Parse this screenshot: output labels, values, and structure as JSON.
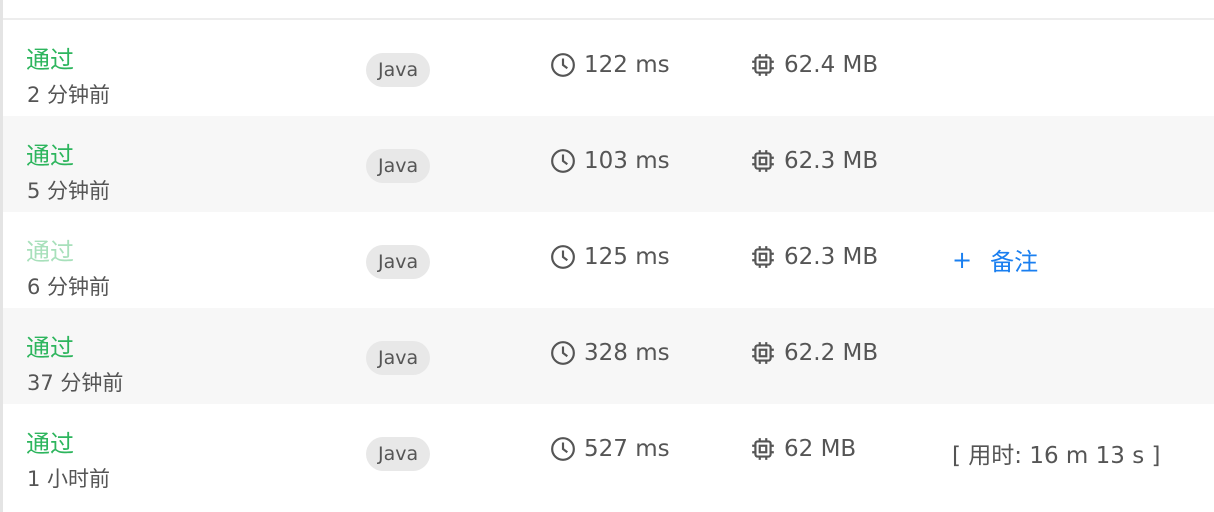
{
  "rows": [
    {
      "status": "通过",
      "time": "2 分钟前",
      "language": "Java",
      "runtime": "122 ms",
      "memory": "62.4 MB",
      "note": ""
    },
    {
      "status": "通过",
      "time": "5 分钟前",
      "language": "Java",
      "runtime": "103 ms",
      "memory": "62.3 MB",
      "note": ""
    },
    {
      "status": "通过",
      "time": "6 分钟前",
      "language": "Java",
      "runtime": "125 ms",
      "memory": "62.3 MB",
      "note": "",
      "add_note": "备注"
    },
    {
      "status": "通过",
      "time": "37 分钟前",
      "language": "Java",
      "runtime": "328 ms",
      "memory": "62.2 MB",
      "note": ""
    },
    {
      "status": "通过",
      "time": "1 小时前",
      "language": "Java",
      "runtime": "527 ms",
      "memory": "62 MB",
      "note": "[ 用时: 16 m 13 s ]"
    }
  ],
  "icons": {
    "runtime": "clock-icon",
    "memory": "chip-icon",
    "add": "plus-icon"
  },
  "colors": {
    "accepted": "#2db55d",
    "link": "#1a7ff0",
    "row_alt": "#f7f7f7"
  }
}
